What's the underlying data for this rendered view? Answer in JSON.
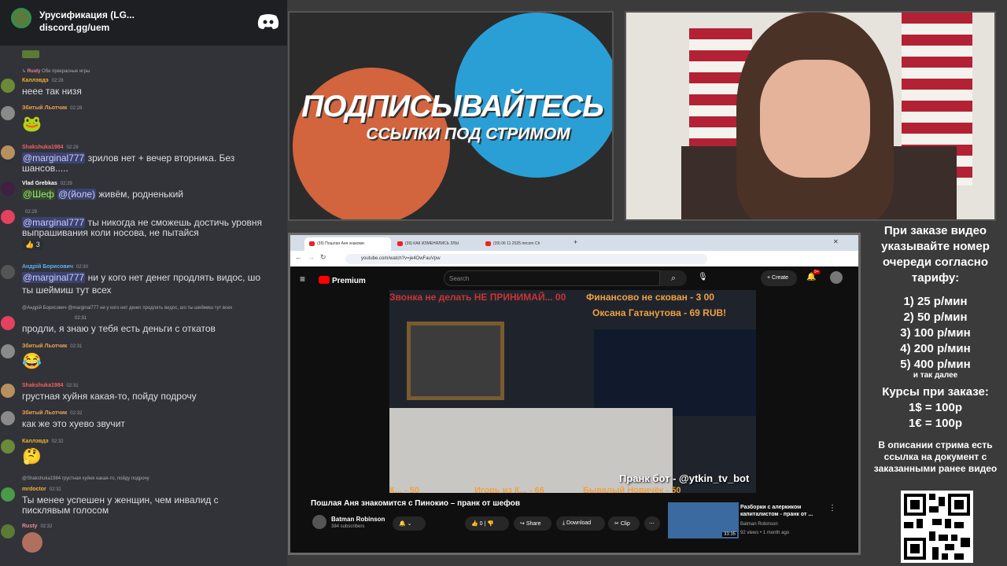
{
  "discord": {
    "title": "Урусификация (LG...",
    "link": "discord.gg/uem",
    "messages": [
      {
        "user": "Rusty",
        "time": "",
        "text": "Обе прекрасные игры",
        "type": "reply"
      },
      {
        "user": "Каллэвдэ",
        "time": "02:28",
        "text": "неее так низя"
      },
      {
        "user": "Збитый Льотчик",
        "time": "02:28",
        "text": "",
        "emoji": "🐸"
      },
      {
        "user": "Shakshuka1984",
        "time": "02:29",
        "mention": "@marginal777",
        "text": "зрилов нет + вечер вторника. Без",
        "text2": "шансов....."
      },
      {
        "user": "Vlad Grebkas",
        "time": "02:29",
        "mention": "@Шеф",
        "mention2": "@(йоле)",
        "text": "живём, родненький"
      },
      {
        "user": "",
        "time": "02:29",
        "mention": "@marginal777",
        "text": "ты никогда не сможешь достичь уровня",
        "text2": "выпрашивания коли носова, не пытайся",
        "react": "3"
      },
      {
        "user": "Андрій Борисович",
        "time": "02:30",
        "mention": "@marginal777",
        "text": "ни у кого нет денег продлять видос, шо",
        "text2": "ты шеймиш тут всех"
      },
      {
        "reply": "@Андрій Борисович @marginal777 ни у кого нет денег продлять видос, шо ты шеймиш тут всех",
        "time": "02:31",
        "text": "продли, я знаю у тебя есть деньги с откатов"
      },
      {
        "user": "Збитый Льотчик",
        "time": "02:31",
        "emoji": "😂"
      },
      {
        "user": "Shakshuka1984",
        "time": "02:31",
        "text": "грустная хуйня какая-то, пойду подрочу"
      },
      {
        "user": "Збитый Льотчик",
        "time": "02:32",
        "text": "как же это хуево звучит"
      },
      {
        "user": "Каллэвдэ",
        "time": "02:32",
        "emoji": "🤔"
      },
      {
        "reply": "@Shakshuka1984 грустная хуйня какая-то, пойду подрочу",
        "user": "mrdoctor",
        "time": "02:32",
        "text": "Ты менее успешен у женщин, чем инвалид с",
        "text2": "писклявым голосом"
      },
      {
        "user": "Rusty",
        "time": "02:32"
      }
    ]
  },
  "promo": {
    "line1": "ПОДПИСЫВАЙТЕСЬ",
    "line2": "ССЫЛКИ ПОД СТРИМОМ"
  },
  "browser": {
    "tabs": [
      "(39) Пошлая Аня знакоми",
      "(39) КАК ИЗМЕНЯЛИСЬ ЗЛЫ",
      "(39) 06 11 2025 mrcom Ch"
    ],
    "url": "youtube.com/watch?v=je4OwFauVpw",
    "yt": {
      "logo": "Premium",
      "search_placeholder": "Search",
      "create": "Create",
      "notif": "9+",
      "overlay": [
        "Звонка не делать НЕ ПРИНИМАЙ... 00",
        "Финансово не скован - 3 00",
        "Оксана Гатанутова - 69 RUB!",
        "Пранк бот - @ytkin_tv_bot",
        "Игорь из К... - 66",
        "Бывалый Новичёк - 50",
        "К... - 50"
      ],
      "title": "Пошлая Аня знакомится с Пинокио – пранк от шефов",
      "channel": "Batman Robinson",
      "subs": "384 subscribers",
      "likes": "0",
      "share": "Share",
      "download": "Download",
      "clip": "Clip",
      "rec_title": "Разборки с алеркиком капиталистом - пранк от ...",
      "rec_channel": "Batman Robinson",
      "rec_meta": "92 views • 1 month ago",
      "rec_duration": "33:35"
    }
  },
  "info": {
    "heading": "При заказе видео указывайте номер очереди согласно тарифу:",
    "tariffs": [
      "1) 25 р/мин",
      "2) 50 р/мин",
      "3) 100 р/мин",
      "4) 200 р/мин",
      "5) 400 р/мин"
    ],
    "more": "и так далее",
    "courses_h": "Курсы при заказе:",
    "rate1": "1$ = 100р",
    "rate2": "1€ = 100р",
    "desc": "В описании стрима есть ссылка на документ с заказанными ранее видео"
  }
}
